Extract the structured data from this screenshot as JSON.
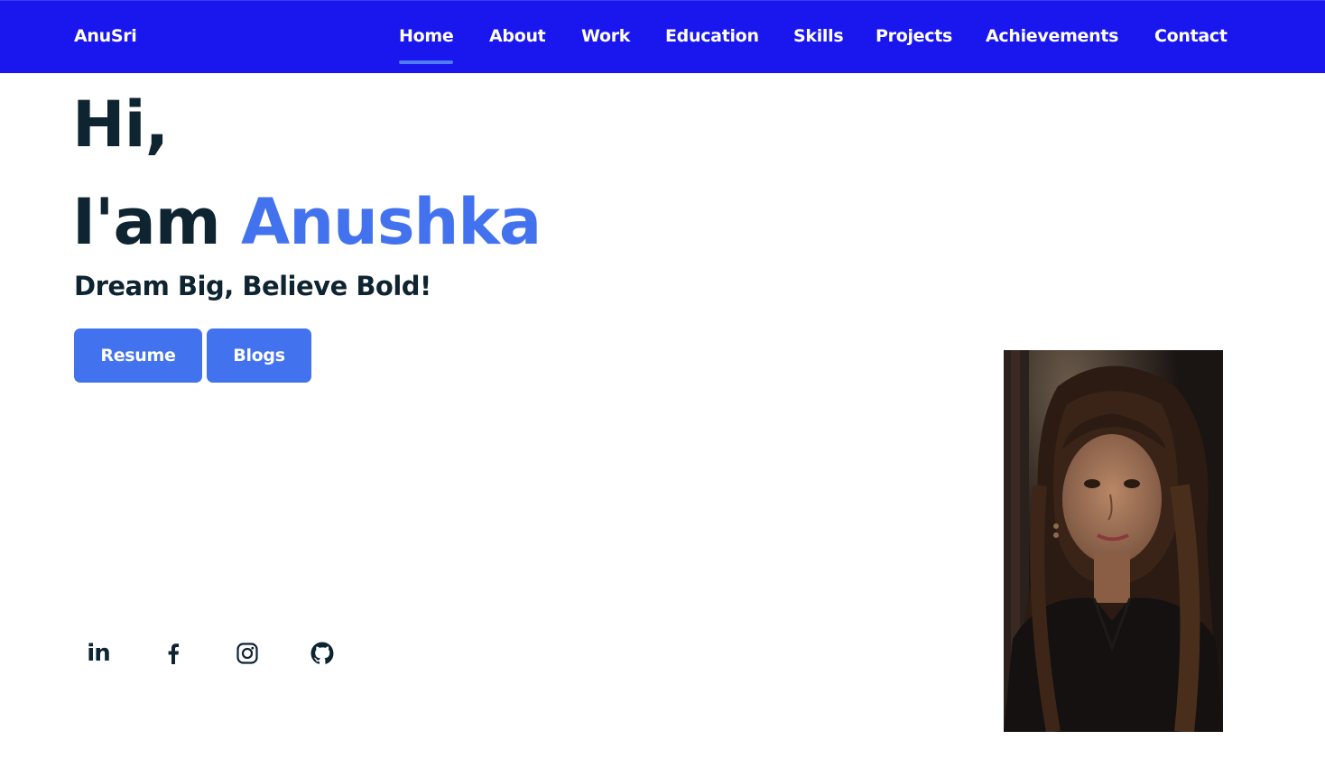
{
  "brand": "AnuSri",
  "nav": {
    "items": [
      {
        "label": "Home",
        "active": true
      },
      {
        "label": "About"
      },
      {
        "label": "Work"
      },
      {
        "label": "Education"
      },
      {
        "label": "Skills"
      },
      {
        "label": "Projects"
      },
      {
        "label": "Achievements"
      },
      {
        "label": "Contact"
      }
    ]
  },
  "hero": {
    "greeting": "Hi,",
    "intro_prefix": "I'am",
    "name": "Anushka",
    "tagline": "Dream Big, Believe Bold!",
    "buttons": {
      "resume": "Resume",
      "blogs": "Blogs"
    }
  },
  "social": {
    "linkedin_glyph": "in",
    "icons": [
      "linkedin-icon",
      "facebook-icon",
      "instagram-icon",
      "github-icon"
    ]
  },
  "colors": {
    "navbar": "#1a16ee",
    "accent": "#4372ef",
    "text": "#0e2431"
  }
}
